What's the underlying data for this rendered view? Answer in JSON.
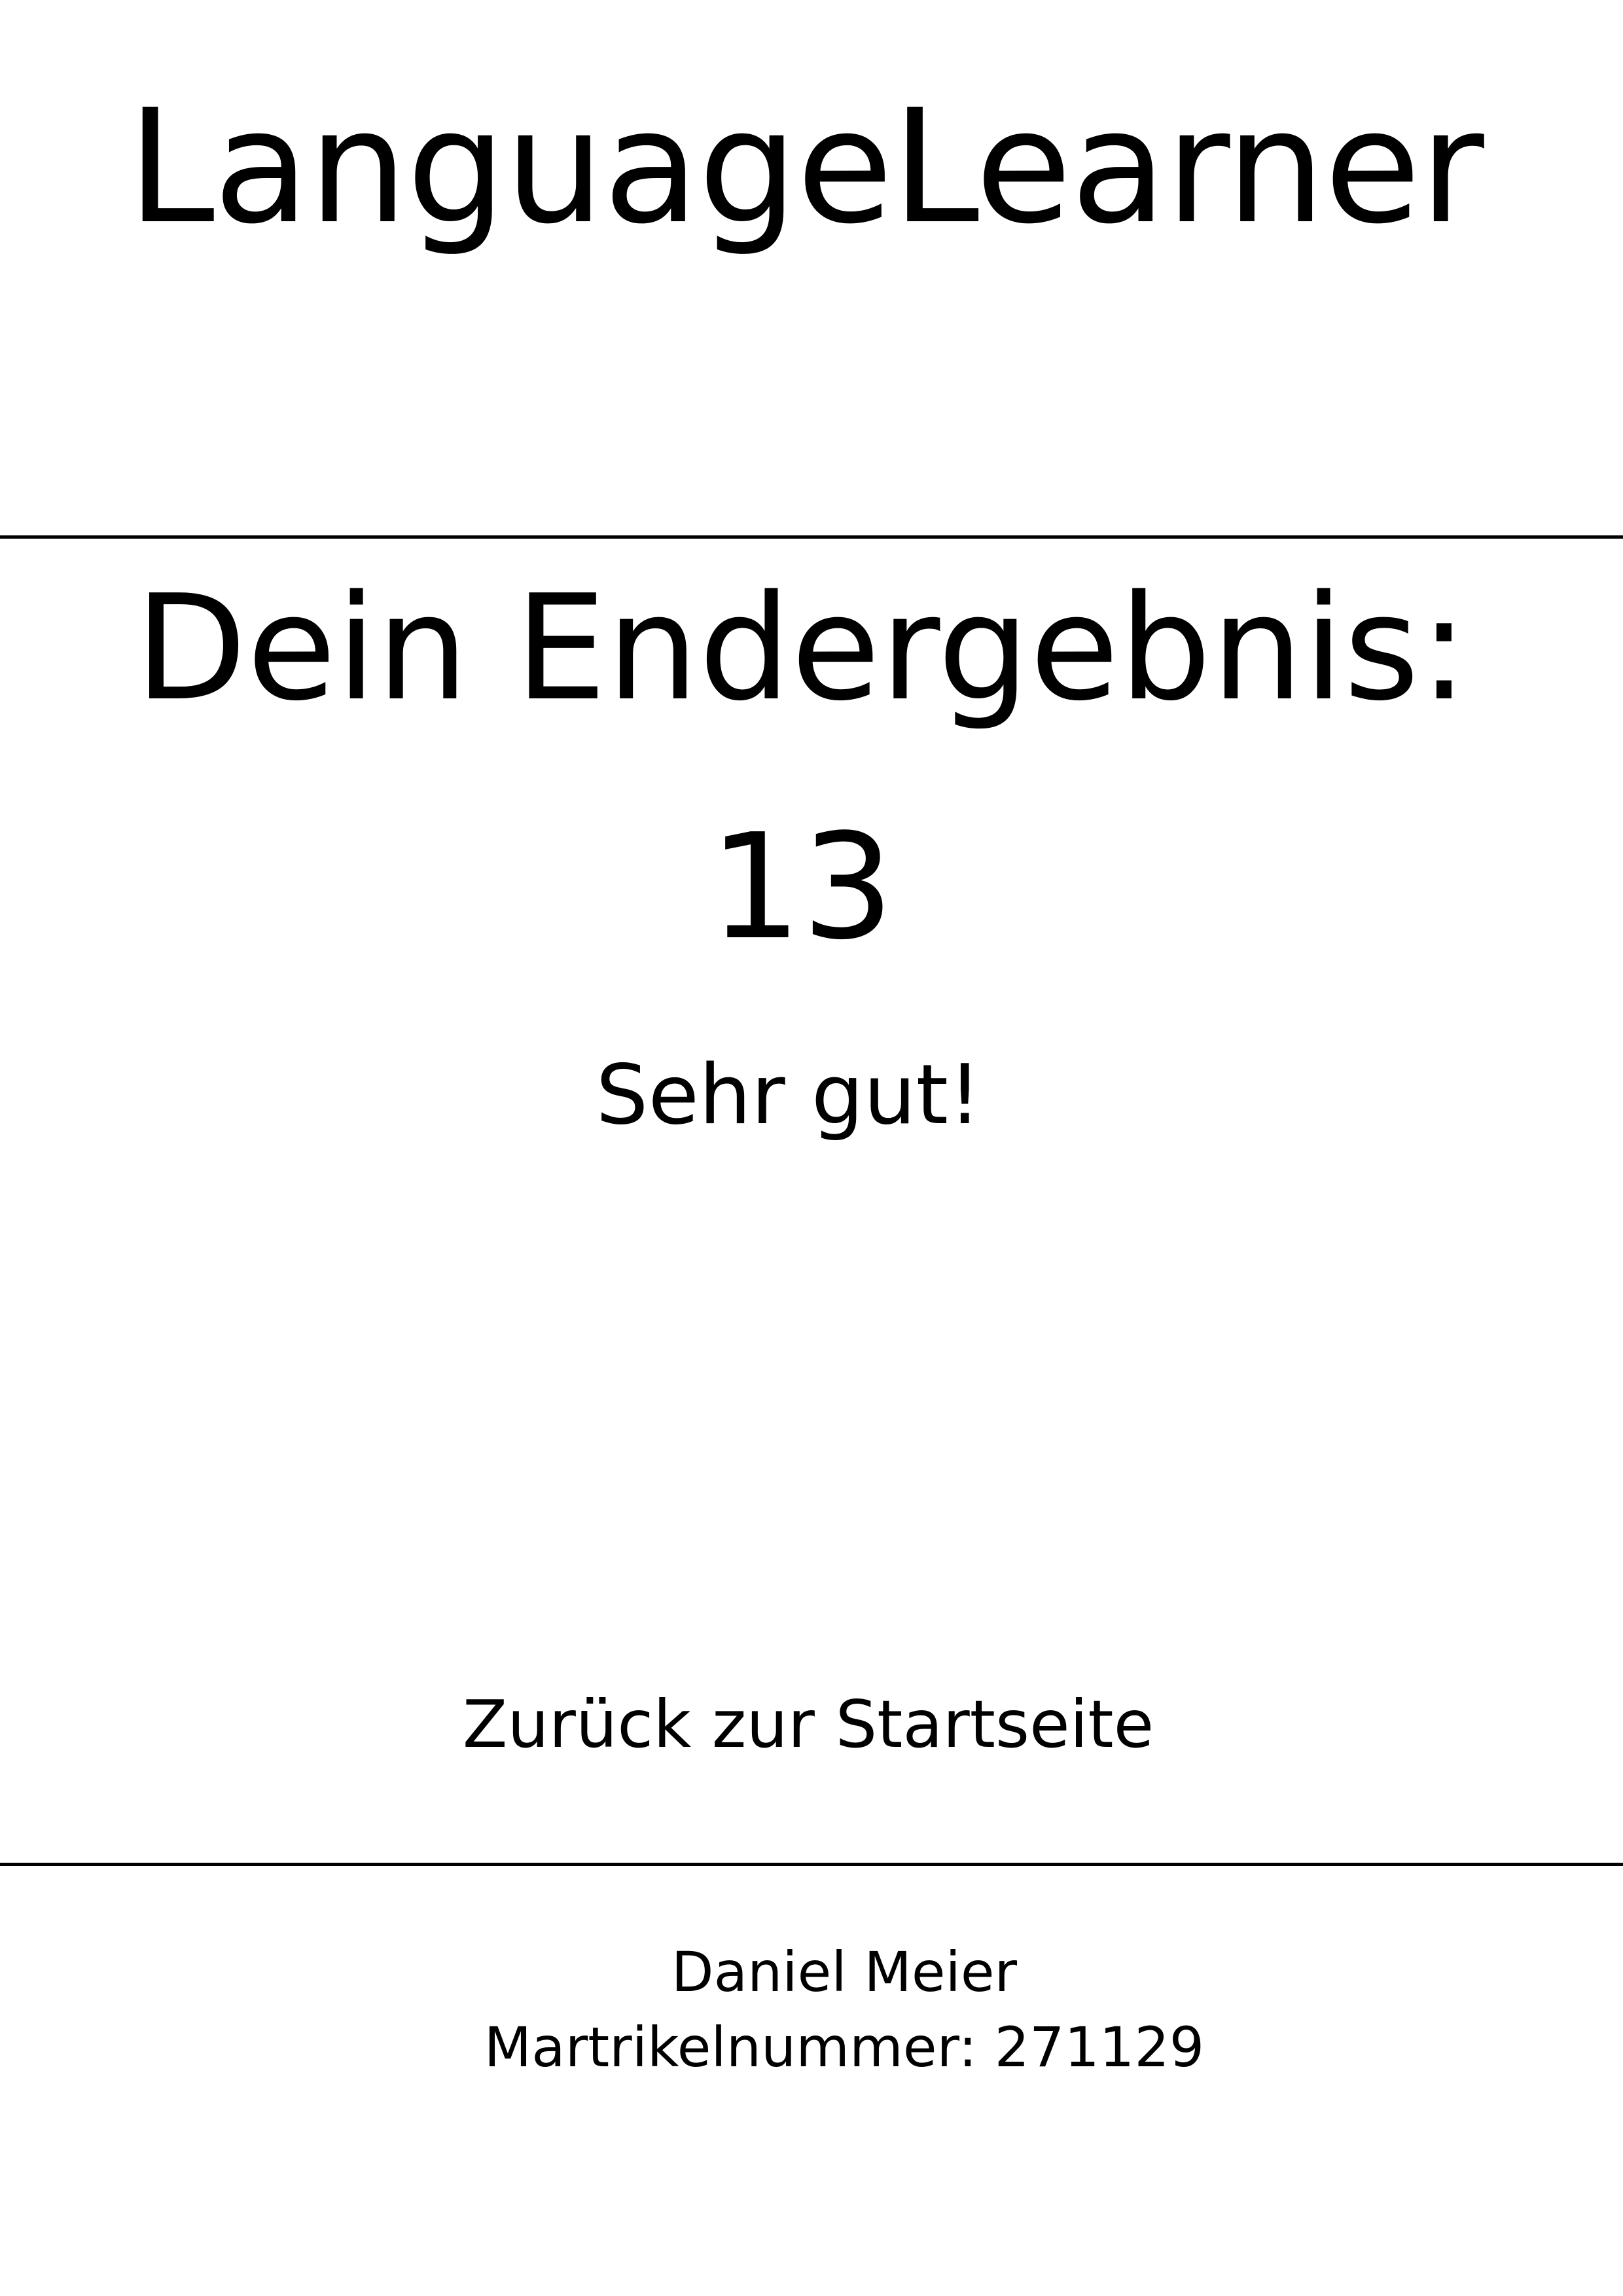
{
  "header": {
    "app_title": "LanguageLearner"
  },
  "result": {
    "heading": "Dein Endergebnis:",
    "score": "13",
    "feedback": "Sehr gut!"
  },
  "navigation": {
    "home_link_label": "Zurück zur Startseite"
  },
  "footer": {
    "student_name": "Daniel Meier",
    "student_id": "Martrikelnummer: 271129"
  }
}
